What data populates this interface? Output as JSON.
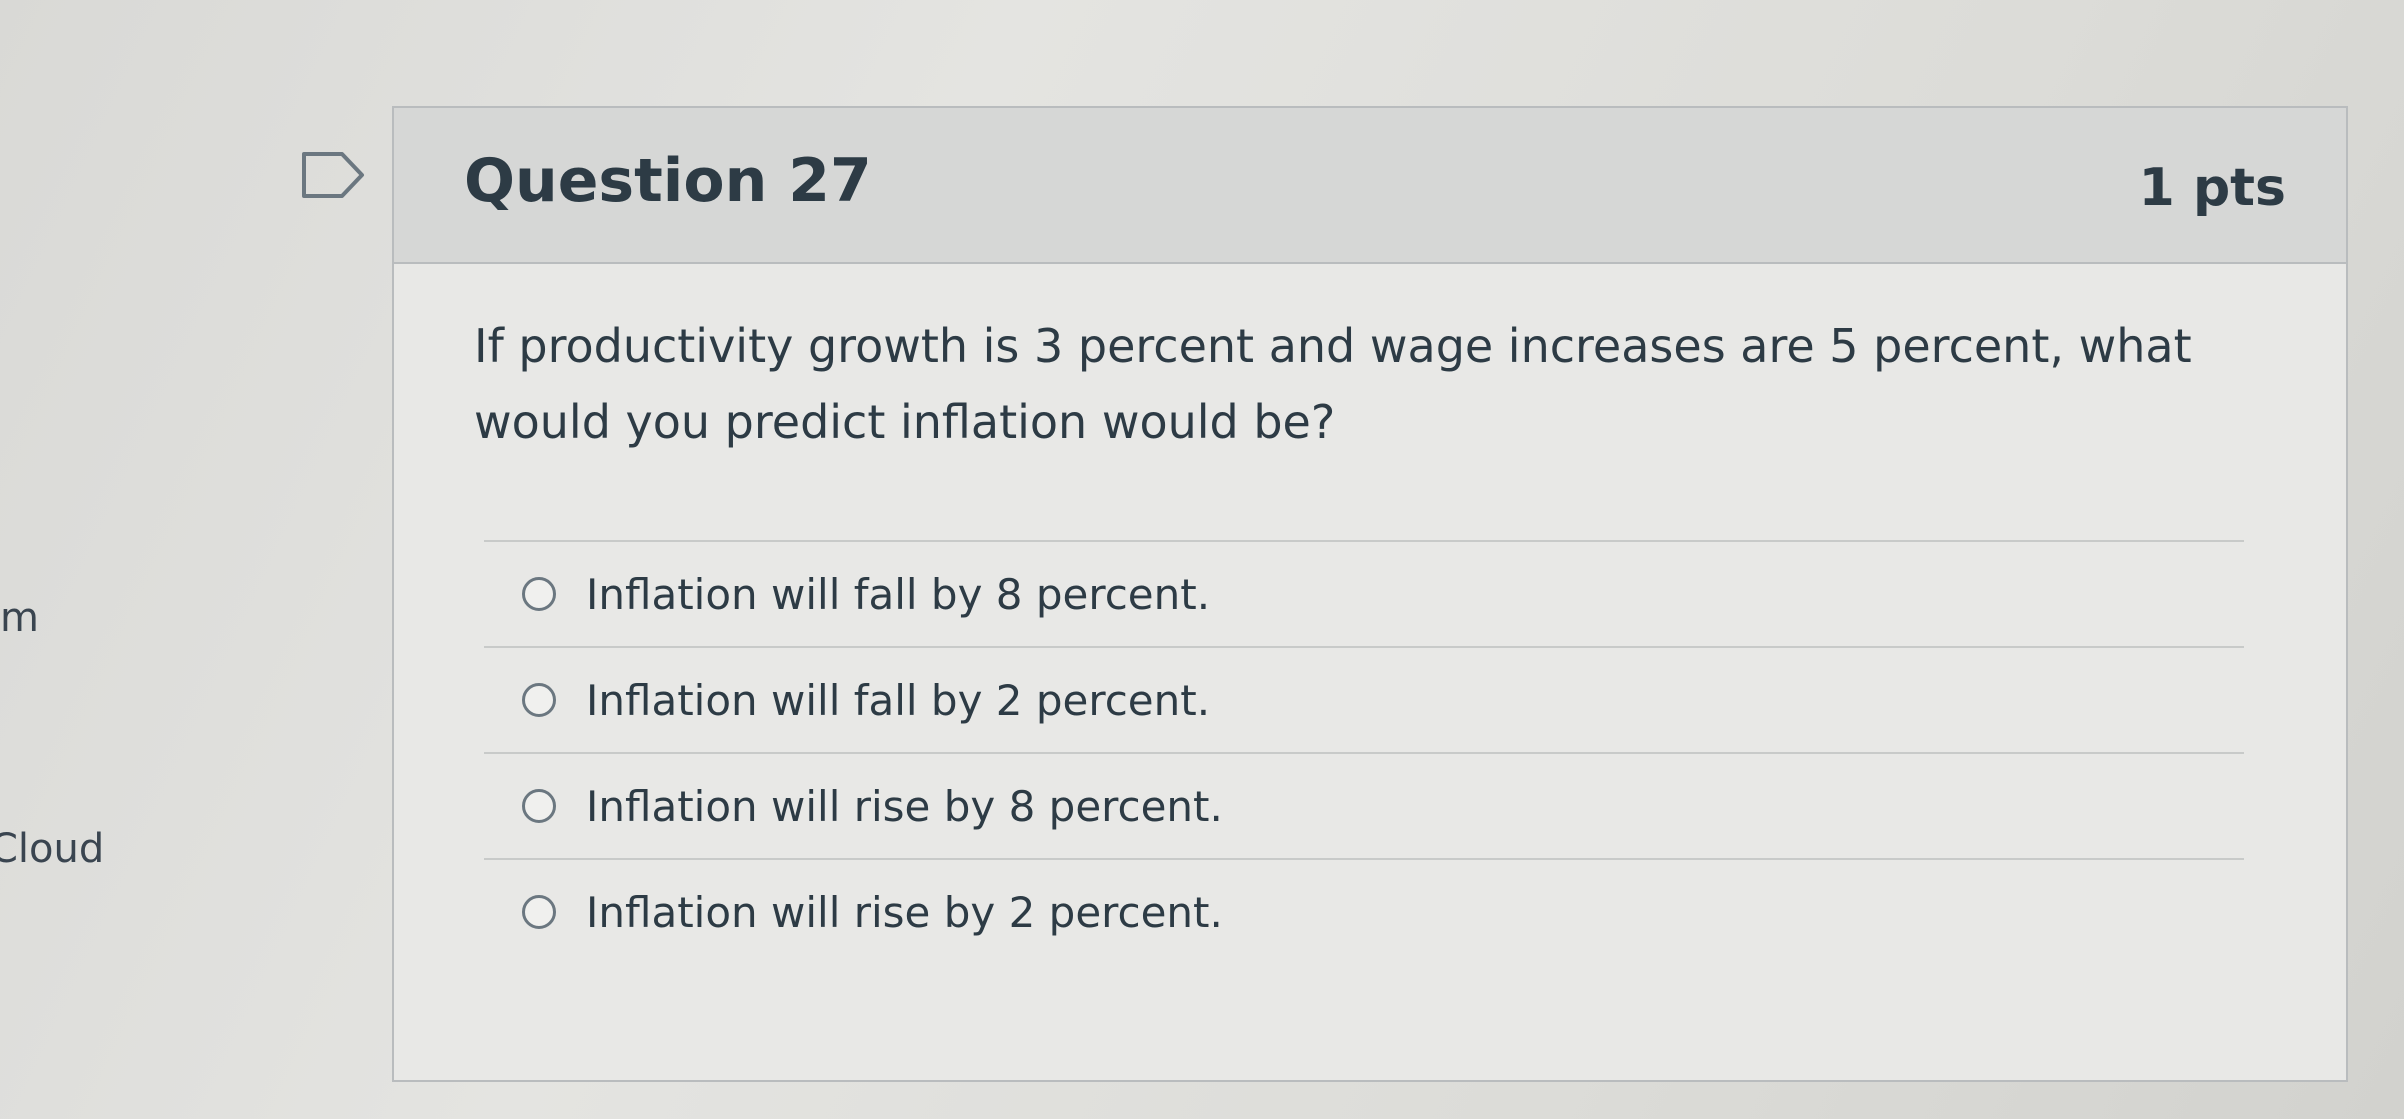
{
  "sidebar_fragments": {
    "m": "m",
    "cloud": "Cloud"
  },
  "question": {
    "title": "Question 27",
    "points": "1 pts",
    "text": "If productivity growth is 3 percent and wage increases are 5 percent, what would you predict inflation would be?",
    "flag_icon": "flag-icon"
  },
  "answers": [
    {
      "label": "Inflation will fall by 8 percent."
    },
    {
      "label": "Inflation will fall by 2 percent."
    },
    {
      "label": "Inflation will rise by 8 percent."
    },
    {
      "label": "Inflation will rise by 2 percent."
    }
  ],
  "colors": {
    "header_bg": "#d6d7d6",
    "text": "#2d3b45",
    "border": "#b9bcbe"
  }
}
